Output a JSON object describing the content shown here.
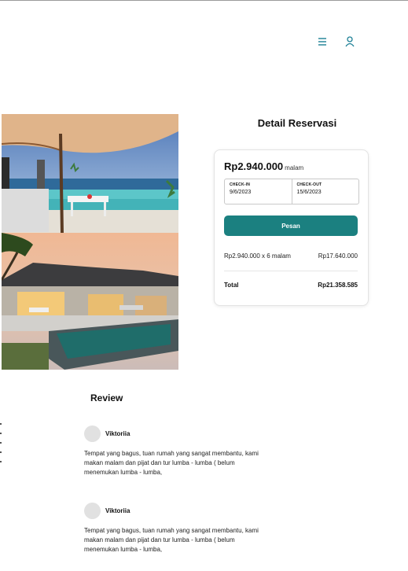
{
  "nav": {
    "menu_icon": "hamburger-menu-icon",
    "user_icon": "user-icon"
  },
  "detail": {
    "title": "Detail Reservasi",
    "price": "Rp2.940.000",
    "per_night": "malam",
    "checkin_label": "CHECK-IN",
    "checkin_value": "9/6/2023",
    "checkout_label": "CHECK-OUT",
    "checkout_value": "15/6/2023",
    "book_label": "Pesan",
    "calc_label": "Rp2.940.000 x 6 malam",
    "calc_amount": "Rp17.640.000",
    "total_label": "Total",
    "total_amount": "Rp21.358.585"
  },
  "reviews": {
    "title": "Review",
    "items": [
      {
        "name": "Viktoriia",
        "text": "Tempat yang bagus, tuan rumah yang sangat membantu, kami makan malam dan pijat dan tur lumba - lumba ( belum menemukan lumba - lumba,"
      },
      {
        "name": "Viktoriia",
        "text": "Tempat yang bagus, tuan rumah yang sangat membantu, kami makan malam dan pijat dan tur lumba - lumba ( belum menemukan lumba - lumba,"
      }
    ]
  },
  "colors": {
    "accent": "#1b8080",
    "nav_icon": "#1b7f95"
  }
}
